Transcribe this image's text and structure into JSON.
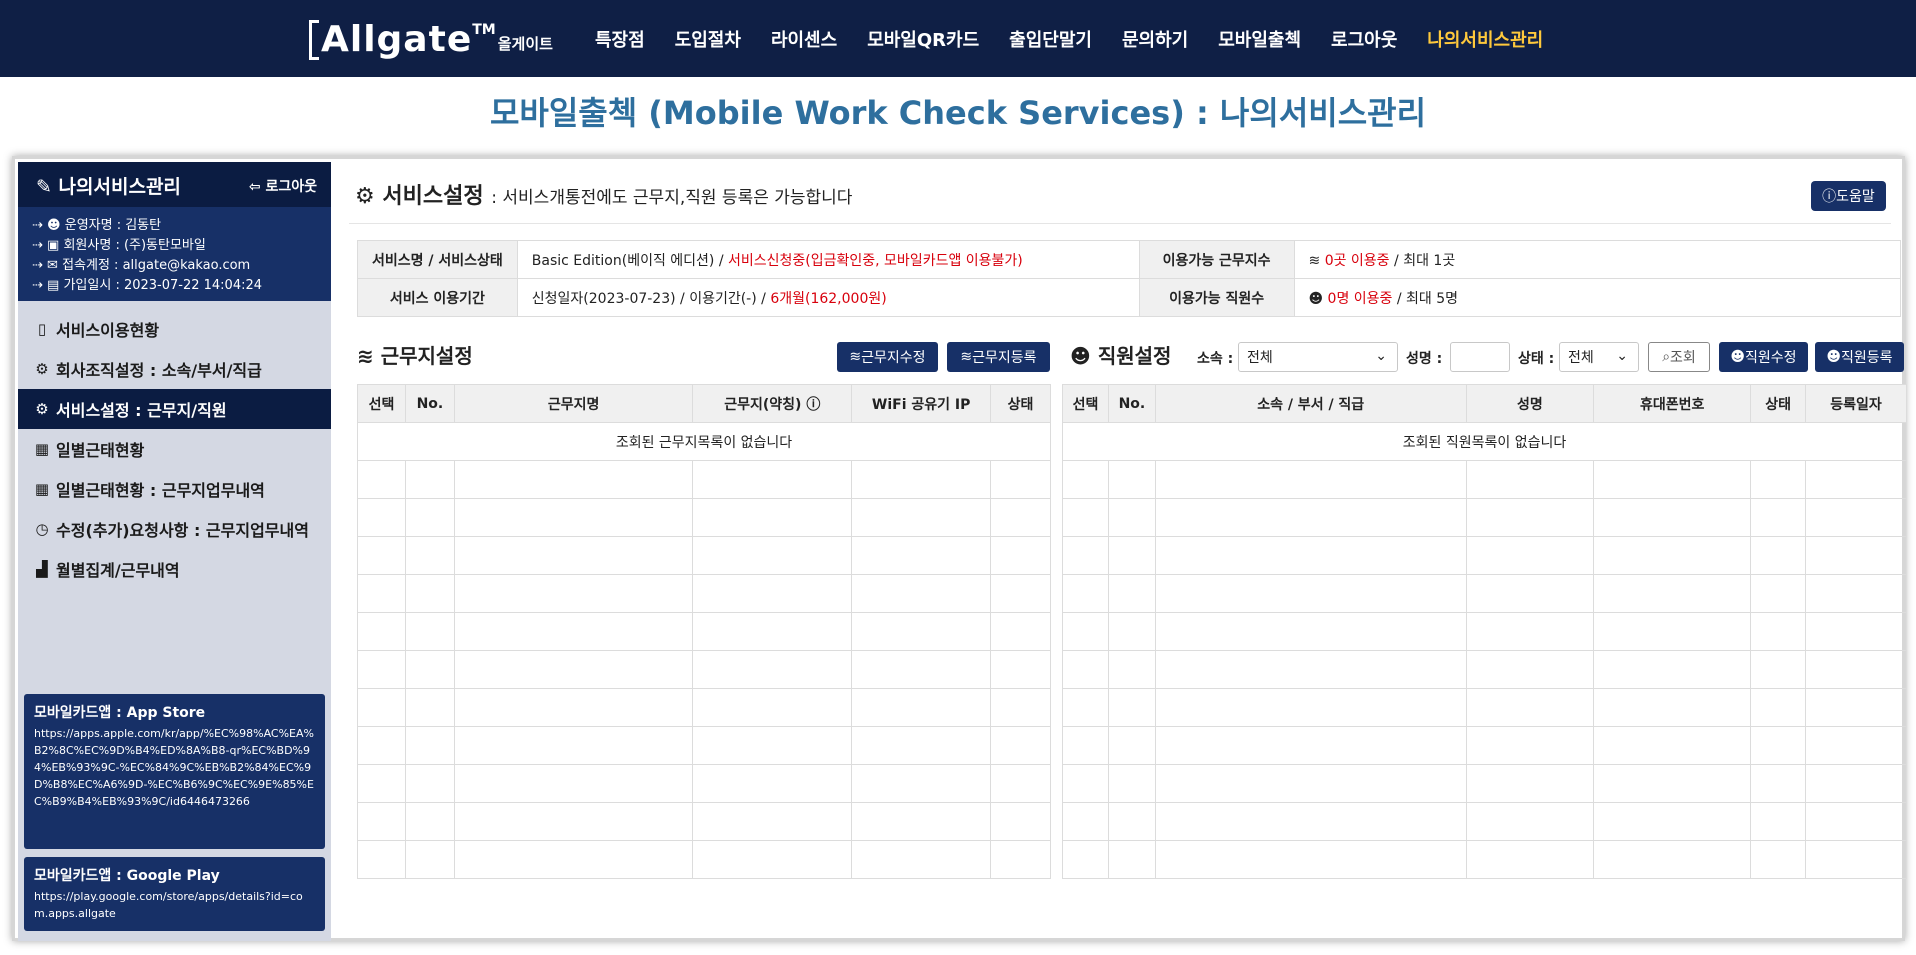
{
  "header": {
    "logo_main": "Allgate",
    "logo_tm": "TM",
    "logo_kr": "올게이트",
    "nav": [
      "특장점",
      "도입절차",
      "라이센스",
      "모바일QR카드",
      "출입단말기",
      "문의하기",
      "모바일출첵",
      "로그아웃",
      "나의서비스관리"
    ],
    "active_nav": "나의서비스관리"
  },
  "page_title": "모바일출첵 (Mobile Work Check Services) : 나의서비스관리",
  "sidebar": {
    "title": "나의서비스관리",
    "logout": "로그아웃",
    "info": [
      "운영자명 : 김동탄",
      "회원사명 : (주)동탄모바일",
      "접속계정 : allgate@kakao.com",
      "가입일시 : 2023-07-22 14:04:24"
    ],
    "menu": [
      {
        "label": "서비스이용현황",
        "icon": "clipboard-icon"
      },
      {
        "label": "회사조직설정 : 소속/부서/직급",
        "icon": "gear-icon"
      },
      {
        "label": "서비스설정 : 근무지/직원",
        "icon": "gear-icon",
        "active": true
      },
      {
        "label": "일별근태현황",
        "icon": "calendar-icon"
      },
      {
        "label": "일별근태현황 : 근무지업무내역",
        "icon": "calendar-icon"
      },
      {
        "label": "수정(추가)요청사항 : 근무지업무내역",
        "icon": "clock-icon"
      },
      {
        "label": "월별집계/근무내역",
        "icon": "bar-chart-icon"
      }
    ],
    "app_store": {
      "title": "모바일카드앱 : App Store",
      "url": "https://apps.apple.com/kr/app/%EC%98%AC%EA%B2%8C%EC%9D%B4%ED%8A%B8-qr%EC%BD%94%EB%93%9C-%EC%84%9C%EB%B2%84%EC%9D%B8%EC%A6%9D-%EC%B6%9C%EC%9E%85%EC%B9%B4%EB%93%9C/id6446473266"
    },
    "google_play": {
      "title": "모바일카드앱 : Google Play",
      "url": "https://play.google.com/store/apps/details?id=com.apps.allgate"
    }
  },
  "service": {
    "title": "서비스설정",
    "subtitle": ": 서비스개통전에도 근무지,직원 등록은 가능합니다",
    "help": "도움말",
    "rows": {
      "name_label": "서비스명 / 서비스상태",
      "edition": "Basic Edition(베이직 에디션) / ",
      "status": "서비스신청중(입금확인중, 모바일카드앱 이용불가)",
      "period_label": "서비스 이용기간",
      "period_text": "신청일자(2023-07-23) / 이용기간(-) / ",
      "period_red": "6개월(162,000원)",
      "sites_label": "이용가능 근무지수",
      "sites_red": "0곳 이용중",
      "sites_max": " / 최대 1곳",
      "staff_label": "이용가능 직원수",
      "staff_red": "0명 이용중",
      "staff_max": " / 최대 5명"
    }
  },
  "worksite": {
    "title": "근무지설정",
    "edit_button": "근무지수정",
    "add_button": "근무지등록",
    "columns": [
      "선택",
      "No.",
      "근무지명",
      "근무지(약칭)",
      "WiFi 공유기 IP",
      "상태"
    ],
    "empty": "조회된 근무지목록이 없습니다"
  },
  "staff": {
    "title": "직원설정",
    "filter_affiliation_label": "소속 :",
    "filter_affiliation_value": "전체",
    "filter_name_label": "성명 :",
    "filter_name_value": "",
    "filter_status_label": "상태 :",
    "filter_status_value": "전체",
    "search_button": "조회",
    "edit_button": "직원수정",
    "add_button": "직원등록",
    "columns": [
      "선택",
      "No.",
      "소속 / 부서 / 직급",
      "성명",
      "휴대폰번호",
      "상태",
      "등록일자"
    ],
    "empty": "조회된 직원목록이 없습니다"
  }
}
